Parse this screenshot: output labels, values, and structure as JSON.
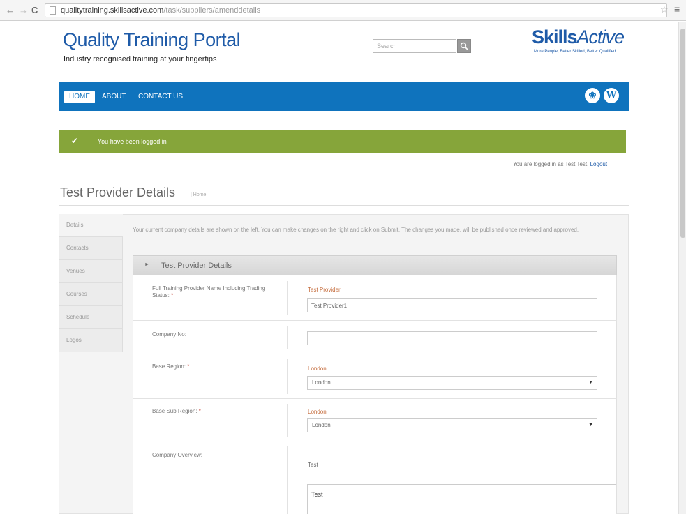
{
  "browser": {
    "url_host": "qualitytraining.skillsactive.com",
    "url_path": "/task/suppliers/amenddetails"
  },
  "header": {
    "title": "Quality Training Portal",
    "tagline": "Industry recognised training at your fingertips",
    "search_placeholder": "Search",
    "logo_skills": "Skills",
    "logo_active": "Active",
    "logo_tagline": "More People, Better Skilled, Better Qualified"
  },
  "nav": {
    "home": "HOME",
    "about": "ABOUT",
    "contact": "CONTACT US"
  },
  "alert": {
    "message": "You have been logged in"
  },
  "session": {
    "logged_in_text": "You are logged in as Test Test.",
    "logout": "Logout"
  },
  "page": {
    "title": "Test Provider Details",
    "breadcrumb": "Home",
    "intro": "Your current company details are shown on the left. You can make changes on the right and click on Submit. The changes you made, will be published once reviewed and approved."
  },
  "side_tabs": [
    "Details",
    "Contacts",
    "Venues",
    "Courses",
    "Schedule",
    "Logos"
  ],
  "section": {
    "title": "Test Provider Details"
  },
  "fields": {
    "provider_name": {
      "label": "Full Training Provider Name Including Trading Status:",
      "required": "*",
      "current": "Test Provider",
      "value": "Test Provider1"
    },
    "company_no": {
      "label": "Company No:",
      "value": ""
    },
    "base_region": {
      "label": "Base Region:",
      "required": "*",
      "current": "London",
      "selected": "London"
    },
    "base_sub_region": {
      "label": "Base Sub Region:",
      "required": "*",
      "current": "London",
      "selected": "London"
    },
    "company_overview": {
      "label": "Company Overview:",
      "current": "Test",
      "value": "Test"
    }
  },
  "colors": {
    "brand_blue": "#1f5ba8",
    "nav_blue": "#0f73bd",
    "alert_green": "#86a53a",
    "current_value_orange": "#c46a3a"
  }
}
